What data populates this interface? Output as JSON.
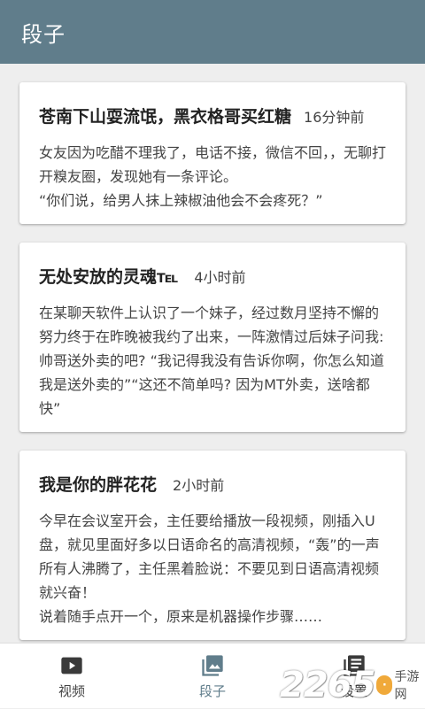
{
  "header": {
    "title": "段子"
  },
  "posts": [
    {
      "title": "苍南下山耍流氓，黑衣格哥买红糖",
      "time": "16分钟前",
      "body": "女友因为吃醋不理我了，电话不接，微信不回，，无聊打开糗友圈，发现她有一条评论。\n“你们说，给男人抹上辣椒油他会不会疼死？”"
    },
    {
      "title": "无处安放的灵魂℡",
      "time": "4小时前",
      "body": "在某聊天软件上认识了一个妹子，经过数月坚持不懈的努力终于在昨晚被我约了出来，一阵激情过后妹子问我:帅哥送外卖的吧? “我记得我没有告诉你啊，你怎么知道我是送外卖的”“这还不简单吗? 因为MT外卖，送啥都快”"
    },
    {
      "title": "我是你的胖花花",
      "time": "2小时前",
      "body": "今早在会议室开会，主任要给播放一段视频，刚插入U盘，就见里面好多以日语命名的高清视频，“轰”的一声所有人沸腾了，主任黑着脸说：不要见到日语高清视频就兴奋！\n说着随手点开一个，原来是机器操作步骤……"
    }
  ],
  "bottom_nav": {
    "items": [
      {
        "label": "视频",
        "icon": "play-icon"
      },
      {
        "label": "段子",
        "icon": "image-icon",
        "active": true
      },
      {
        "label": "设置",
        "icon": "settings-list-icon"
      }
    ]
  },
  "watermark": {
    "number": "2265",
    "badge": "·",
    "text": "手游网"
  },
  "colors": {
    "header_bg": "#607d8b",
    "active_nav": "#607d8b",
    "card_bg": "#ffffff",
    "page_bg": "#eeeeee"
  }
}
